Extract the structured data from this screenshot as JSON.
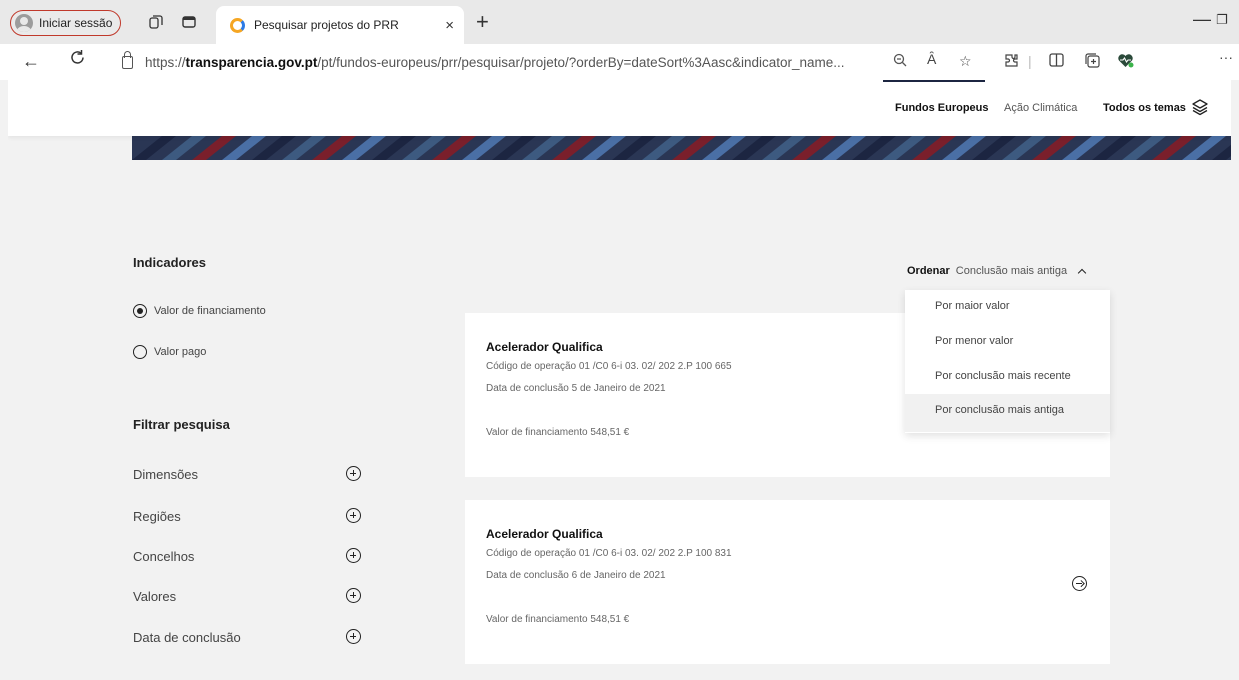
{
  "browser": {
    "profile_label": "Iniciar sessão",
    "tab_title": "Pesquisar projetos do PRR",
    "tab_close": "×",
    "new_tab": "+",
    "url_prefix": "https://",
    "url_host": "transparencia.gov.pt",
    "url_path": "/pt/fundos-europeus/prr/pesquisar/projeto/?orderBy=dateSort%3Aasc&indicator_name...",
    "read_aloud": "Ȃ"
  },
  "header": {
    "nav": [
      {
        "label": "Fundos Europeus"
      },
      {
        "label": "Ação Climática"
      },
      {
        "label": "Todos os temas"
      }
    ]
  },
  "sidebar": {
    "indicators_title": "Indicadores",
    "indicators": [
      {
        "label": "Valor de financiamento",
        "selected": true
      },
      {
        "label": "Valor pago",
        "selected": false
      }
    ],
    "filter_title": "Filtrar pesquisa",
    "filters": [
      {
        "label": "Dimensões"
      },
      {
        "label": "Regiões"
      },
      {
        "label": "Concelhos"
      },
      {
        "label": "Valores"
      },
      {
        "label": "Data de conclusão"
      }
    ]
  },
  "sort": {
    "label": "Ordenar",
    "current": "Conclusão mais antiga",
    "options": [
      {
        "label": "Por maior valor"
      },
      {
        "label": "Por menor valor"
      },
      {
        "label": "Por conclusão mais recente"
      },
      {
        "label": "Por conclusão mais antiga",
        "selected": true
      }
    ]
  },
  "results": [
    {
      "title": "Acelerador Qualifica",
      "code": "Código de operação 01 /C0 6-i 03. 02/ 202 2.P 100 665",
      "date": "Data de conclusão 5 de Janeiro de 2021",
      "value": "Valor de financiamento  548,51 €"
    },
    {
      "title": "Acelerador Qualifica",
      "code": "Código de operação 01 /C0 6-i 03. 02/ 202 2.P 100 831",
      "date": "Data de conclusão 6 de Janeiro de 2021",
      "value": "Valor de financiamento  548,51 €"
    }
  ],
  "colors": {
    "accent": "#1c2541",
    "banner_dark": "#1c2541",
    "banner_blue": "#3d5a80",
    "banner_red": "#7a1f2b",
    "profile_border": "#c0392b"
  }
}
